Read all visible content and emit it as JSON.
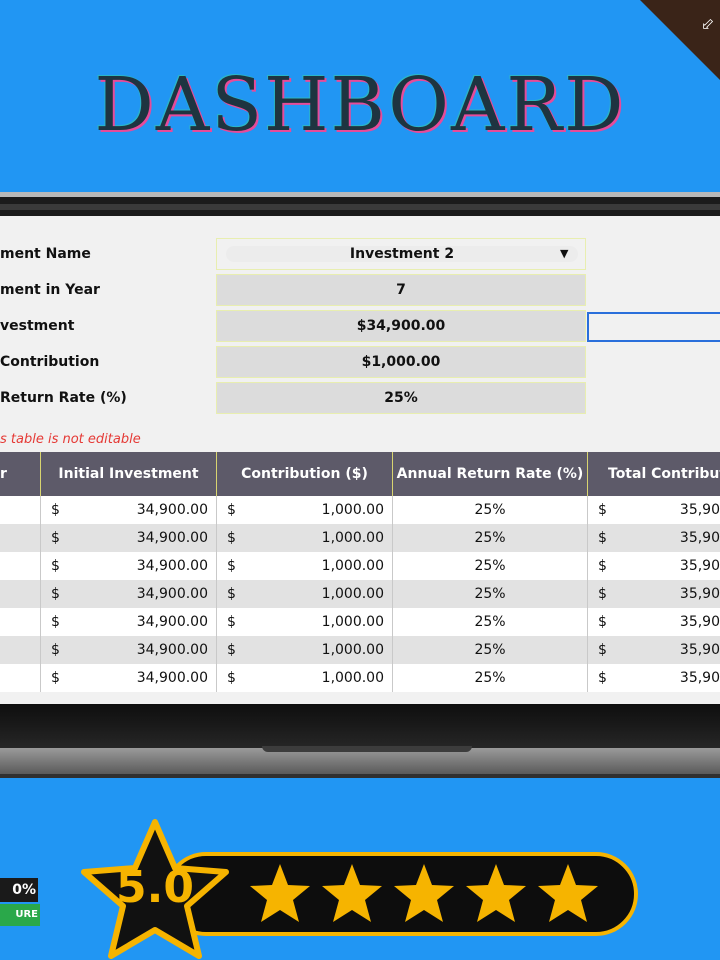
{
  "header": {
    "title": "DASHBOARD",
    "corner_icon": "download-icon"
  },
  "form": {
    "rows": [
      {
        "label": "ment Name",
        "value": "Investment 2",
        "type": "dropdown"
      },
      {
        "label": "ment in Year",
        "value": "7"
      },
      {
        "label": "vestment",
        "value": "$34,900.00"
      },
      {
        "label": "Contribution",
        "value": "$1,000.00"
      },
      {
        "label": "Return Rate (%)",
        "value": "25%"
      }
    ],
    "note": "s table is not editable"
  },
  "table": {
    "headers": [
      "r",
      "Initial Investment",
      "Contribution ($)",
      "Annual Return Rate (%)",
      "Total Contributi"
    ],
    "rows": [
      {
        "initial_cur": "$",
        "initial": "34,900.00",
        "contrib_cur": "$",
        "contrib": "1,000.00",
        "rate": "25%",
        "total_cur": "$",
        "total": "35,90"
      },
      {
        "initial_cur": "$",
        "initial": "34,900.00",
        "contrib_cur": "$",
        "contrib": "1,000.00",
        "rate": "25%",
        "total_cur": "$",
        "total": "35,90"
      },
      {
        "initial_cur": "$",
        "initial": "34,900.00",
        "contrib_cur": "$",
        "contrib": "1,000.00",
        "rate": "25%",
        "total_cur": "$",
        "total": "35,90"
      },
      {
        "initial_cur": "$",
        "initial": "34,900.00",
        "contrib_cur": "$",
        "contrib": "1,000.00",
        "rate": "25%",
        "total_cur": "$",
        "total": "35,90"
      },
      {
        "initial_cur": "$",
        "initial": "34,900.00",
        "contrib_cur": "$",
        "contrib": "1,000.00",
        "rate": "25%",
        "total_cur": "$",
        "total": "35,90"
      },
      {
        "initial_cur": "$",
        "initial": "34,900.00",
        "contrib_cur": "$",
        "contrib": "1,000.00",
        "rate": "25%",
        "total_cur": "$",
        "total": "35,90"
      },
      {
        "initial_cur": "$",
        "initial": "34,900.00",
        "contrib_cur": "$",
        "contrib": "1,000.00",
        "rate": "25%",
        "total_cur": "$",
        "total": "35,90"
      }
    ]
  },
  "rating": {
    "score": "5.0",
    "stars": 5,
    "badge_percent": "0%",
    "badge_text": "URE",
    "colors": {
      "gold": "#f6b400",
      "bar": "#0d0d0d"
    }
  },
  "colors": {
    "background": "#2196f3",
    "header_bg": "#5d5a69",
    "note": "#e53935"
  }
}
